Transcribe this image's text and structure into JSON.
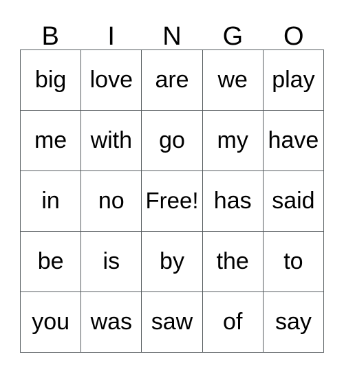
{
  "card": {
    "title_letters": [
      "B",
      "I",
      "N",
      "G",
      "O"
    ],
    "free_space_label": "Free!",
    "grid": {
      "rows": 5,
      "columns": 5,
      "border_color": "#555b5e",
      "background_color": "#ffffff",
      "text_color": "#000000",
      "cells": [
        [
          "big",
          "love",
          "are",
          "we",
          "play"
        ],
        [
          "me",
          "with",
          "go",
          "my",
          "have"
        ],
        [
          "in",
          "no",
          "Free!",
          "has",
          "said"
        ],
        [
          "be",
          "is",
          "by",
          "the",
          "to"
        ],
        [
          "you",
          "was",
          "saw",
          "of",
          "say"
        ]
      ]
    }
  }
}
